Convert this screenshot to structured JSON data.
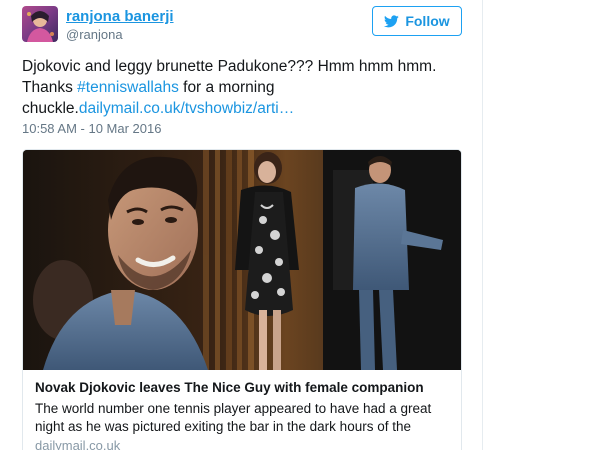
{
  "header": {
    "display_name": "ranjona banerji",
    "handle": "@ranjona",
    "follow_label": "Follow"
  },
  "tweet": {
    "text_line1": "Djokovic and leggy brunette Padukone??? Hmm hmm hmm.",
    "text_thanks": "Thanks ",
    "hashtag": "#tenniswallahs",
    "text_after_hashtag": " for a morning",
    "text_chuckle": "chuckle.",
    "link": "dailymail.co.uk/tvshowbiz/arti…",
    "timestamp": "10:58 AM - 10 Mar 2016"
  },
  "card": {
    "title": "Novak Djokovic leaves The Nice Guy with female companion",
    "description": "The world number one tennis player appeared to have had a great night as he was pictured exiting the bar in the dark hours of the",
    "domain": "dailymail.co.uk"
  },
  "colors": {
    "link": "#1b95e0",
    "follow_border": "#1da1f2",
    "text": "#14171a",
    "muted": "#657786"
  },
  "icons": {
    "follow": "twitter-bird-icon"
  }
}
